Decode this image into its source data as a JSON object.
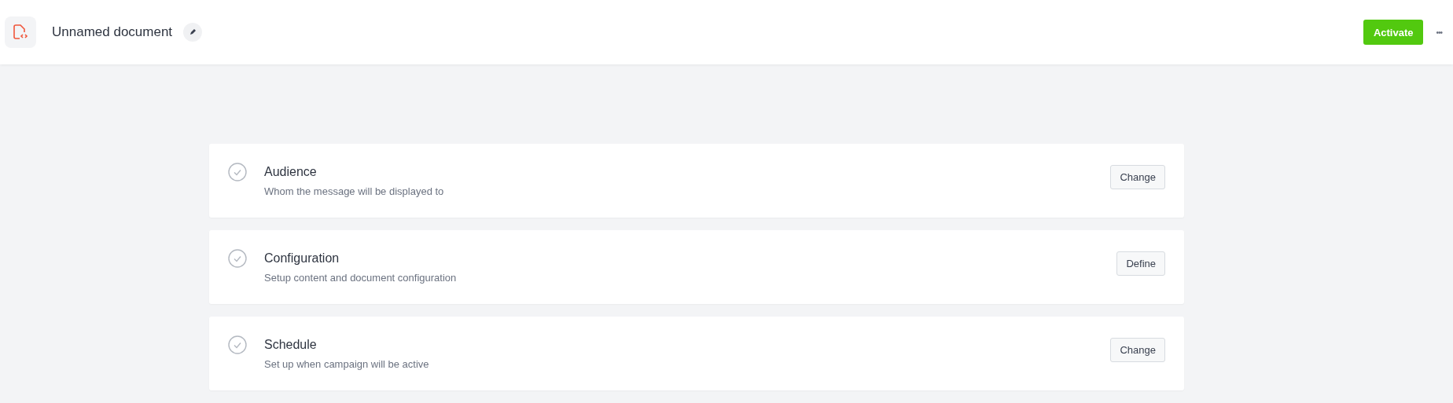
{
  "header": {
    "title": "Unnamed document",
    "activate_button": "Activate",
    "more_button": "•••"
  },
  "steps": [
    {
      "title": "Audience",
      "description": "Whom the message will be displayed to",
      "action": "Change"
    },
    {
      "title": "Configuration",
      "description": "Setup content and document configuration",
      "action": "Define"
    },
    {
      "title": "Schedule",
      "description": "Set up when campaign will be active",
      "action": "Change"
    }
  ]
}
